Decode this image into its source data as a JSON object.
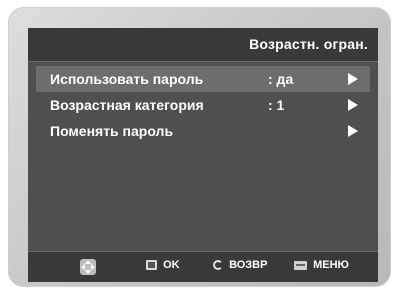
{
  "header": {
    "title": "Возрастн. огран."
  },
  "menu": {
    "items": [
      {
        "label": "Использовать пароль",
        "value": ": да",
        "arrow": "play-right-icon"
      },
      {
        "label": "Возрастная категория",
        "value": ": 1",
        "arrow": "play-right-icon"
      },
      {
        "label": "Поменять пароль",
        "value": "",
        "arrow": "play-right-icon"
      }
    ]
  },
  "footer": {
    "move_icon": "dpad-icon",
    "ok_label": "OK",
    "back_label": "ВОЗВР",
    "menu_label": "МЕНЮ"
  }
}
